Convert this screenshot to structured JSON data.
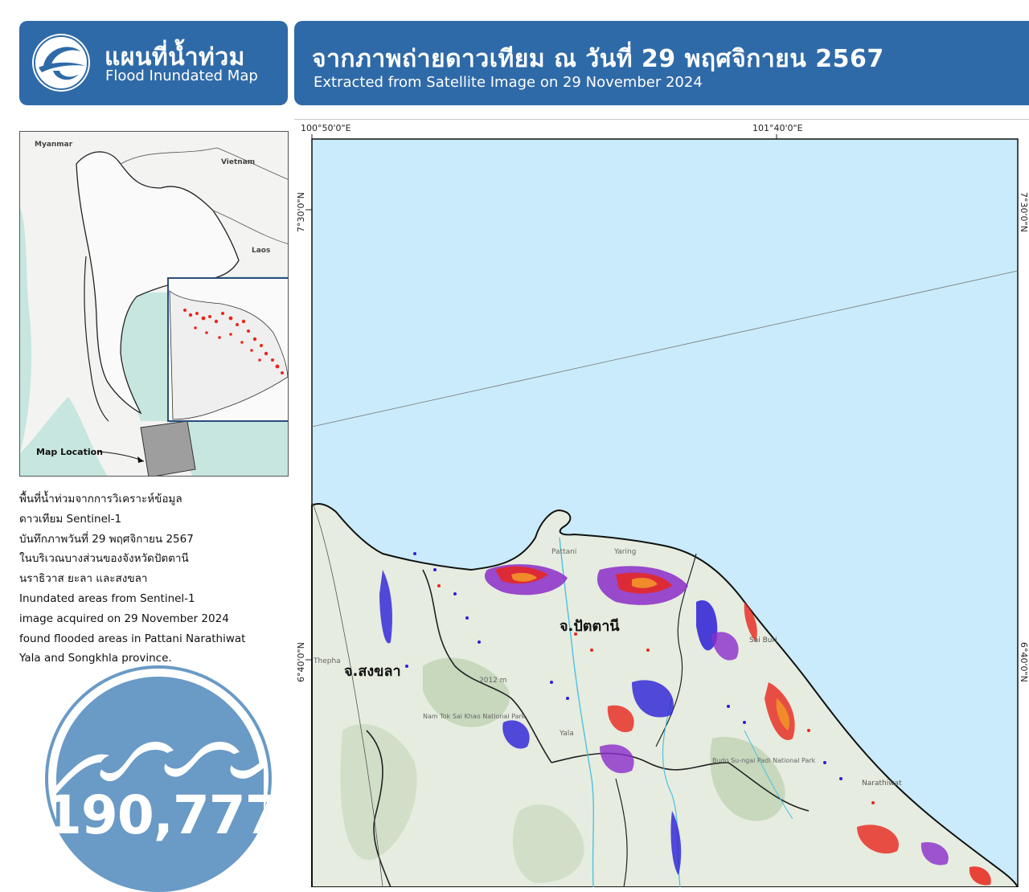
{
  "header_left": {
    "title_thai": "แผนที่น้ำท่วม",
    "title_en": "Flood Inundated Map"
  },
  "header_right": {
    "title_thai": "จากภาพถ่ายดาวเทียม ณ วันที่ 29 พฤศจิกายน 2567",
    "title_en": "Extracted from Satellite Image on 29 November 2024"
  },
  "inset_map": {
    "labels": {
      "myanmar": "Myanmar",
      "vietnam": "Vietnam",
      "laos": "Laos",
      "map_location": "Map Location"
    }
  },
  "description": [
    "พื้นที่น้ำท่วมจากการวิเคราะห์ข้อมูล",
    "ดาวเทียม Sentinel-1",
    "บันทึกภาพวันที่ 29 พฤศจิกายน 2567",
    "ในบริเวณบางส่วนของจังหวัดปัตตานี",
    "นราธิวาส ยะลา และสงขลา",
    "Inundated areas from Sentinel-1",
    "image acquired on 29 November 2024",
    "found flooded areas in Pattani Narathiwat",
    "Yala and Songkhla province."
  ],
  "flood_badge": {
    "value": "190,777"
  },
  "main_map": {
    "lon_ticks": [
      "100°50'0\"E",
      "101°40'0\"E"
    ],
    "lat_ticks": [
      "7°30'0\"N",
      "6°40'0\"N"
    ],
    "province_labels": {
      "pattani": "จ.ปัตตานี",
      "songkhla": "จ.สงขลา"
    },
    "place_labels": {
      "pattani_town": "Pattani",
      "yaring": "Yaring",
      "sai_buri": "Sai Buri",
      "narathiwat": "Narathiwat",
      "yala": "Yala",
      "thepha": "Thepha",
      "mountain": "2012 m",
      "nam_tok_sai_khao": "Nam Tok Sai Khao National Park",
      "budo_sungai_padi": "Budo Su-ngai Padi National Park"
    }
  },
  "colors": {
    "header_bg": "#2f6aa8",
    "badge_bg": "#6a9ac6",
    "sea": "#c9ebfb",
    "flood_red": "#e8261c",
    "flood_orange": "#f08a2a",
    "flood_blue": "#2b1fd6",
    "flood_purple": "#8b2dc9"
  }
}
